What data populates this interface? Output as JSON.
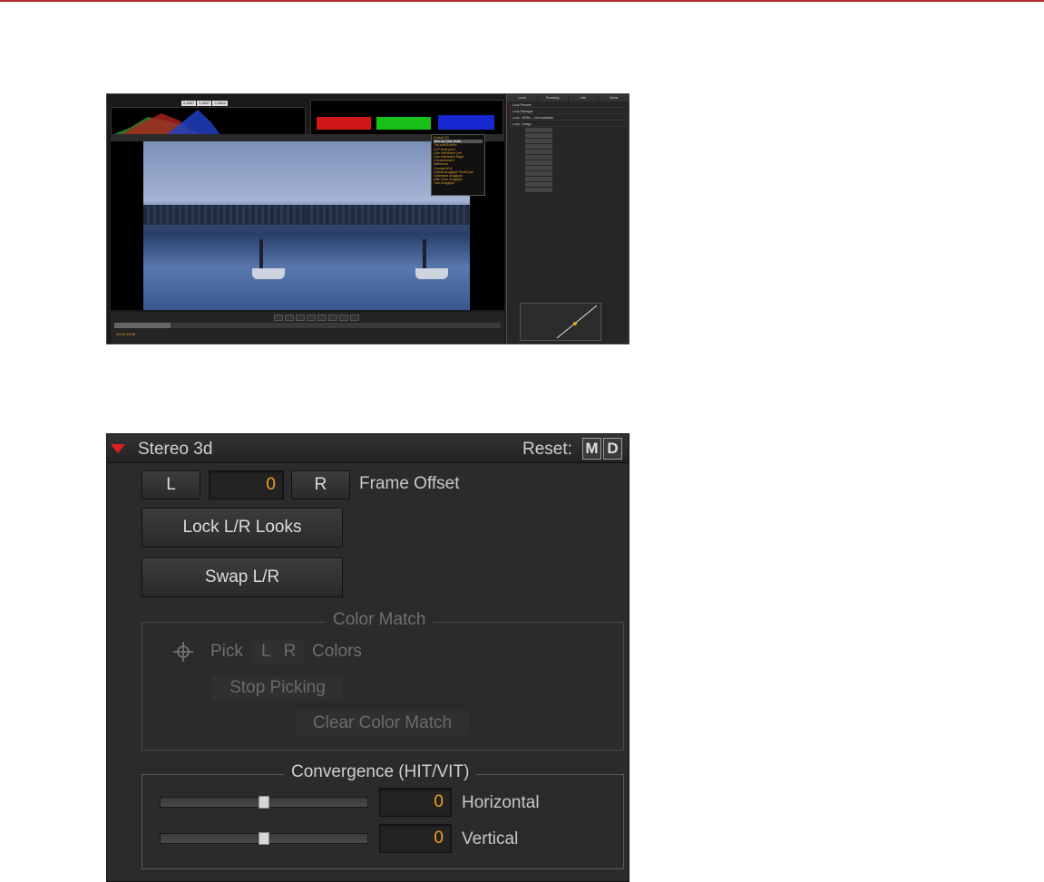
{
  "thumbnail": {
    "readout_values": [
      "0.4607",
      "0.4007",
      "0.2604"
    ],
    "dropdown_items": [
      "Default 2D",
      "Side-by-Side (Half)",
      "Top-and-Bottom",
      "DLP Dual pixel",
      "Line Interleave Left",
      "Line Interleave Right",
      "Checkerboard",
      "Difference",
      "Overlay 50%",
      "Dubois Anaglyph Red/Cyan",
      "Optimized Anaglyph",
      "Half-Color Anaglyph",
      "True Anaglyph"
    ],
    "side_tabs": [
      "Look",
      "Framing",
      "Info",
      "Meta"
    ],
    "side_rows": [
      "Look Presets",
      "Look Manager",
      "Look : HDRx – Not available",
      "Look : Image"
    ],
    "timecode": "10:00:16:08"
  },
  "panel": {
    "title": "Stereo 3d",
    "reset_label": "Reset:",
    "m_label": "M",
    "d_label": "D",
    "frame_offset": {
      "l_label": "L",
      "value": "0",
      "r_label": "R",
      "label": "Frame Offset"
    },
    "lock_button": "Lock L/R Looks",
    "swap_button": "Swap L/R",
    "color_match": {
      "legend": "Color Match",
      "pick_label": "Pick",
      "l_label": "L",
      "r_label": "R",
      "colors_label": "Colors",
      "stop_button": "Stop Picking",
      "clear_button": "Clear Color Match"
    },
    "convergence": {
      "legend": "Convergence (HIT/VIT)",
      "horizontal_value": "0",
      "horizontal_label": "Horizontal",
      "horizontal_level": 0.5,
      "vertical_value": "0",
      "vertical_label": "Vertical",
      "vertical_level": 0.5
    }
  },
  "colors": {
    "accent_red": "#e02020",
    "value_orange": "#f0a020",
    "panel_bg": "#2b2b2b"
  }
}
